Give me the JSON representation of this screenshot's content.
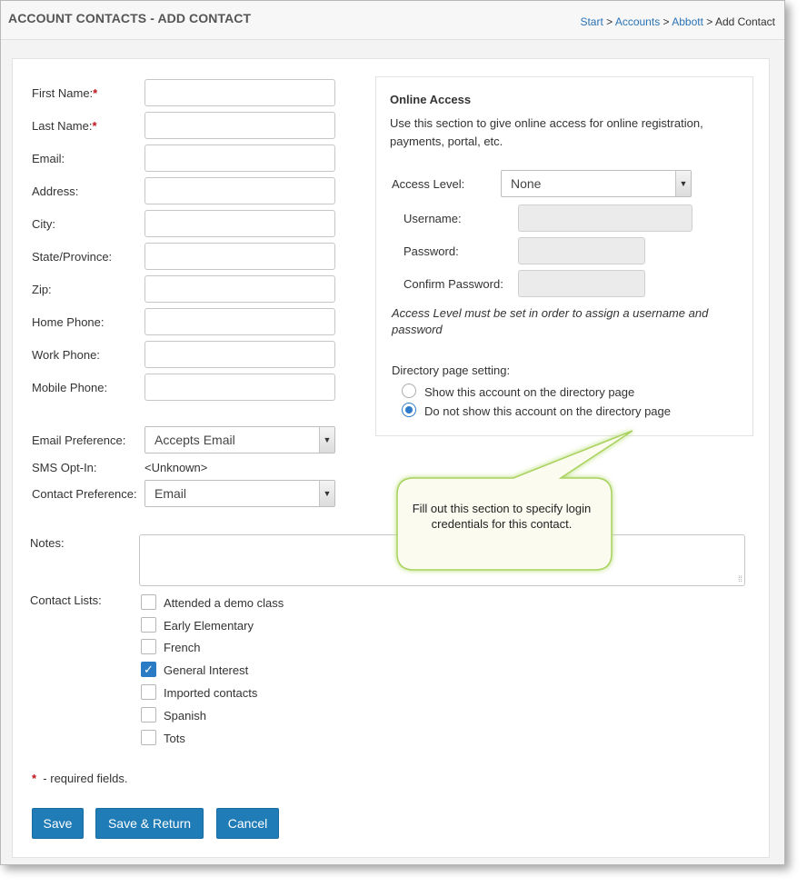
{
  "header": {
    "title": "ACCOUNT CONTACTS - ADD CONTACT",
    "breadcrumb": {
      "start": "Start",
      "sep": ">",
      "accounts": "Accounts",
      "abbott": "Abbott",
      "current": "Add Contact"
    }
  },
  "form": {
    "required_mark": "*",
    "fields": {
      "first_name": "First Name:",
      "last_name": "Last Name:",
      "email": "Email:",
      "address": "Address:",
      "city": "City:",
      "state": "State/Province:",
      "zip": "Zip:",
      "home_phone": "Home Phone:",
      "work_phone": "Work Phone:",
      "mobile_phone": "Mobile Phone:"
    },
    "email_preference": {
      "label": "Email Preference:",
      "value": "Accepts Email"
    },
    "sms_opt_in": {
      "label": "SMS Opt-In:",
      "value": "<Unknown>"
    },
    "contact_preference": {
      "label": "Contact Preference:",
      "value": "Email"
    },
    "notes_label": "Notes:",
    "contact_lists": {
      "label": "Contact Lists:",
      "items": [
        {
          "label": "Attended a demo class",
          "checked": false
        },
        {
          "label": "Early Elementary",
          "checked": false
        },
        {
          "label": "French",
          "checked": false
        },
        {
          "label": "General Interest",
          "checked": true
        },
        {
          "label": "Imported contacts",
          "checked": false
        },
        {
          "label": "Spanish",
          "checked": false
        },
        {
          "label": "Tots",
          "checked": false
        }
      ]
    },
    "required_note": "- required fields."
  },
  "online_access": {
    "title": "Online Access",
    "description": "Use this section to give online access for online registration, payments, portal, etc.",
    "access_level": {
      "label": "Access Level:",
      "value": "None"
    },
    "username_label": "Username:",
    "password_label": "Password:",
    "confirm_password_label": "Confirm Password:",
    "note": "Access Level must be set in order to assign a username and password",
    "directory": {
      "label": "Directory page setting:",
      "options": [
        {
          "label": "Show this account on the directory page",
          "selected": false
        },
        {
          "label": "Do not show this account on the directory page",
          "selected": true
        }
      ]
    }
  },
  "callout": {
    "text": "Fill out this section to specify login credentials for this contact."
  },
  "buttons": {
    "save": "Save",
    "save_return": "Save & Return",
    "cancel": "Cancel"
  },
  "colors": {
    "primary_button": "#1f7cb7",
    "link": "#2a73b5",
    "required": "#c0141b",
    "callout_fill": "#fbfbf0",
    "callout_glow": "#c8e890"
  }
}
